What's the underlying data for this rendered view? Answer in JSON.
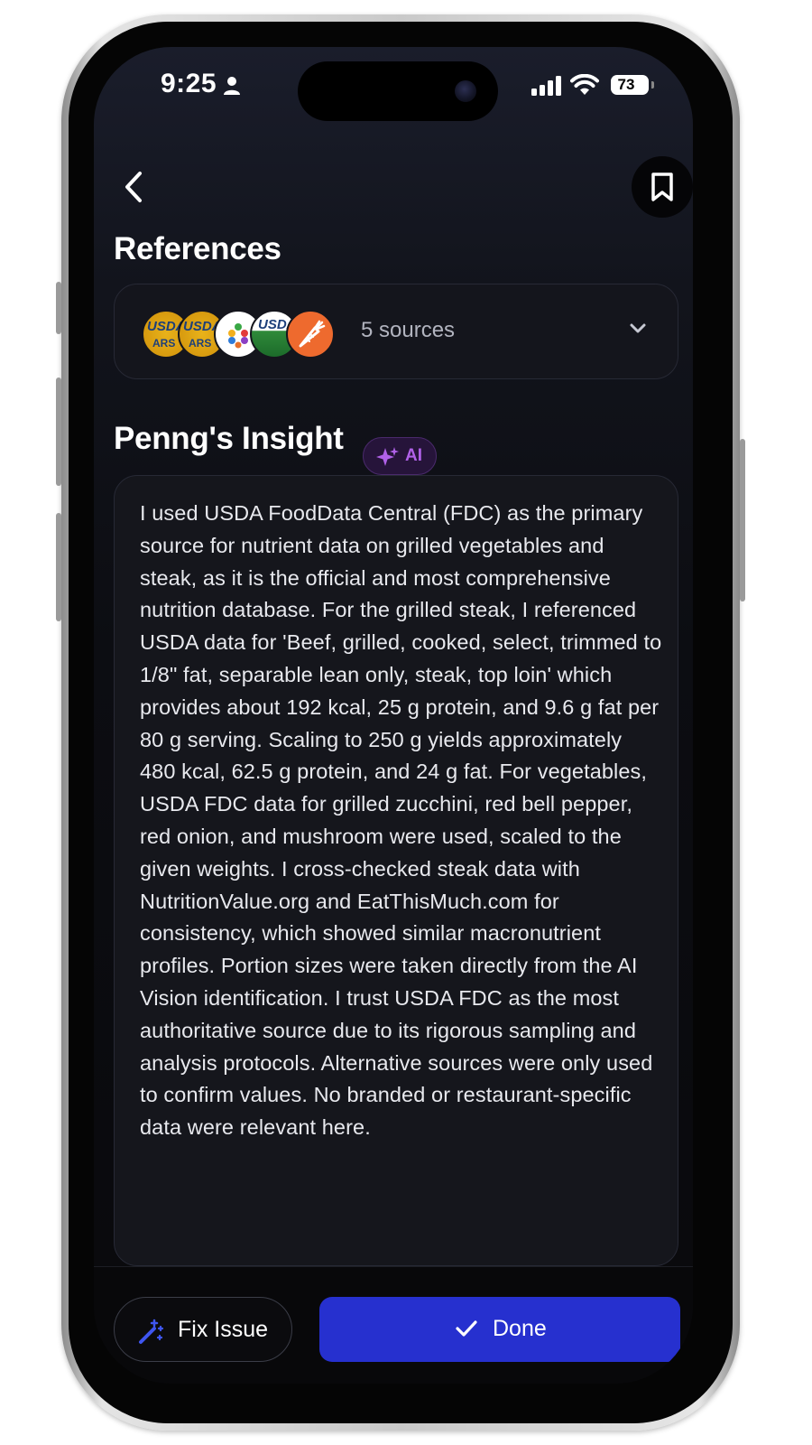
{
  "status_bar": {
    "time": "9:25",
    "battery": "73"
  },
  "header": {
    "back_icon": "chevron-left-icon",
    "bookmark_icon": "bookmark-icon"
  },
  "references": {
    "title": "References",
    "sources_label": "5 sources",
    "logos": [
      {
        "name": "usda-ars-logo",
        "text_top": "USDA",
        "text_bottom": "ARS"
      },
      {
        "name": "usda-ars-logo",
        "text_top": "USDA",
        "text_bottom": "ARS"
      },
      {
        "name": "apple-logo"
      },
      {
        "name": "usda-logo",
        "text_top": "USDA"
      },
      {
        "name": "carrot-logo"
      }
    ]
  },
  "insight": {
    "title": "Penng's Insight",
    "badge": "AI",
    "body": "I used USDA FoodData Central (FDC) as the primary source for nutrient data on grilled vegetables and steak, as it is the official and most comprehensive nutrition database. For the grilled steak, I referenced USDA data for 'Beef, grilled, cooked, select, trimmed to 1/8\" fat, separable lean only, steak, top loin' which provides about 192 kcal, 25 g protein, and 9.6 g fat per 80 g serving. Scaling to 250 g yields approximately 480 kcal, 62.5 g protein, and 24 g fat. For vegetables, USDA FDC data for grilled zucchini, red bell pepper, red onion, and mushroom were used, scaled to the given weights. I cross-checked steak data with NutritionValue.org and EatThisMuch.com for consistency, which showed similar macronutrient profiles. Portion sizes were taken directly from the AI Vision identification. I trust USDA FDC as the most authoritative source due to its rigorous sampling and analysis protocols. Alternative sources were only used to confirm values. No branded or restaurant-specific data were relevant here."
  },
  "actions": {
    "fix_label": "Fix Issue",
    "done_label": "Done"
  },
  "colors": {
    "accent": "#2630cf",
    "ai_badge": "#b061e8",
    "background": "#0c0d12"
  }
}
